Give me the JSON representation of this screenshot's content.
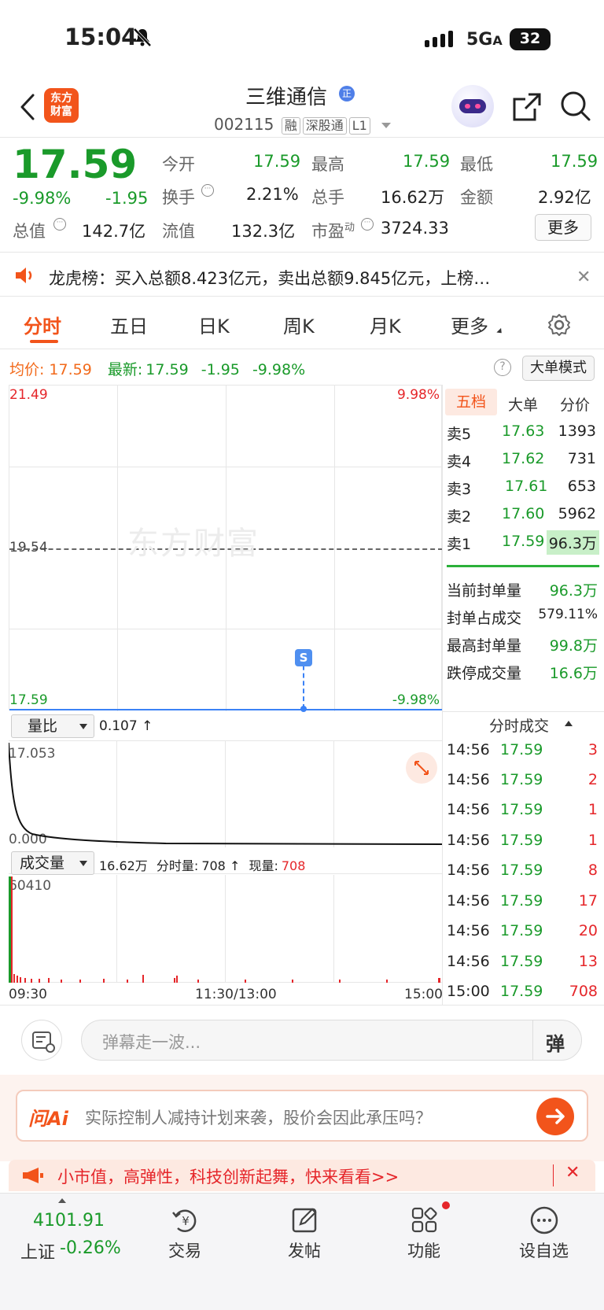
{
  "status_bar": {
    "time": "15:04",
    "network": "5G",
    "battery": "32"
  },
  "header": {
    "logo_line1": "东方",
    "logo_line2": "财富",
    "stock_name": "三维通信",
    "stock_code": "002115",
    "tags": [
      "融",
      "深股通",
      "L1"
    ]
  },
  "quote": {
    "price": "17.59",
    "change_pct": "-9.98%",
    "change": "-1.95",
    "open_label": "今开",
    "open": "17.59",
    "high_label": "最高",
    "high": "17.59",
    "low_label": "最低",
    "low": "17.59",
    "turnover_label": "换手",
    "turnover": "2.21%",
    "volume_label": "总手",
    "volume": "16.62万",
    "amount_label": "金额",
    "amount": "2.92亿",
    "mcap_label": "总值",
    "mcap": "142.7亿",
    "float_label": "流值",
    "float_cap": "132.3亿",
    "pe_label": "市盈",
    "pe_sup": "动",
    "pe": "3724.33",
    "more_button": "更多"
  },
  "notice": {
    "text": "龙虎榜：买入总额8.423亿元，卖出总额9.845亿元，上榜…"
  },
  "tabs": [
    "分时",
    "五日",
    "日K",
    "周K",
    "月K",
    "更多"
  ],
  "summary": {
    "avg_label": "均价:",
    "avg": "17.59",
    "latest_label": "最新:",
    "latest": "17.59",
    "change": "-1.95",
    "change_pct": "-9.98%",
    "big_order_mode": "大单模式"
  },
  "intraday": {
    "y_top": "21.49",
    "y_top_pct": "9.98%",
    "y_mid": "19.54",
    "y_bottom": "17.59",
    "y_bottom_pct": "-9.98%",
    "marker": "S",
    "watermark": "东方财富"
  },
  "volume_ratio": {
    "select": "量比",
    "value": "0.107 ↑",
    "y_top": "17.053",
    "y_bottom": "0.000"
  },
  "volume": {
    "select": "成交量",
    "total": "16.62万",
    "period_label": "分时量:",
    "period": "708 ↑",
    "current_label": "现量:",
    "current": "708",
    "y_top": "60410",
    "time_start": "09:30",
    "time_mid": "11:30/13:00",
    "time_end": "15:00"
  },
  "order_book": {
    "tabs": [
      "五档",
      "大单",
      "分价"
    ],
    "asks": [
      {
        "label": "卖5",
        "price": "17.63",
        "qty": "1393"
      },
      {
        "label": "卖4",
        "price": "17.62",
        "qty": "731"
      },
      {
        "label": "卖3",
        "price": "17.61",
        "qty": "653"
      },
      {
        "label": "卖2",
        "price": "17.60",
        "qty": "5962"
      },
      {
        "label": "卖1",
        "price": "17.59",
        "qty": "96.3万"
      }
    ],
    "stats": [
      {
        "label": "当前封单量",
        "value": "96.3万"
      },
      {
        "label": "封单占成交",
        "value": "579.11%"
      },
      {
        "label": "最高封单量",
        "value": "99.8万"
      },
      {
        "label": "跌停成交量",
        "value": "16.6万"
      }
    ]
  },
  "ticks": {
    "title": "分时成交",
    "rows": [
      {
        "time": "14:56",
        "price": "17.59",
        "qty": "3"
      },
      {
        "time": "14:56",
        "price": "17.59",
        "qty": "2"
      },
      {
        "time": "14:56",
        "price": "17.59",
        "qty": "1"
      },
      {
        "time": "14:56",
        "price": "17.59",
        "qty": "1"
      },
      {
        "time": "14:56",
        "price": "17.59",
        "qty": "8"
      },
      {
        "time": "14:56",
        "price": "17.59",
        "qty": "17"
      },
      {
        "time": "14:56",
        "price": "17.59",
        "qty": "20"
      },
      {
        "time": "14:56",
        "price": "17.59",
        "qty": "13"
      },
      {
        "time": "15:00",
        "price": "17.59",
        "qty": "708"
      }
    ]
  },
  "danmu": {
    "placeholder": "弹幕走一波...",
    "button": "弹"
  },
  "ai": {
    "logo": "问Ai",
    "question": "实际控制人减持计划来袭，股价会因此承压吗？"
  },
  "promo": {
    "text": "小市值，高弹性，科技创新起舞，快来看看>>"
  },
  "bottom_nav": {
    "index_value": "4101.91",
    "index_name": "上证",
    "index_change": "-0.26%",
    "items": [
      "交易",
      "发帖",
      "功能",
      "设自选"
    ]
  },
  "colors": {
    "up": "#e5262a",
    "down": "#1a9a2a",
    "accent": "#f26a1b",
    "link": "#3b82f6"
  }
}
